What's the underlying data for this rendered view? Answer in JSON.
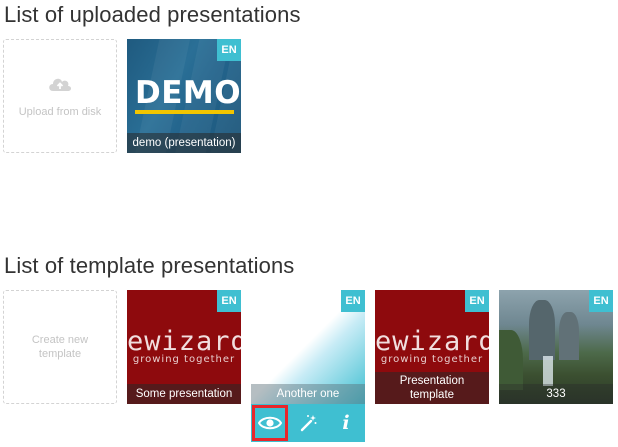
{
  "uploaded": {
    "title": "List of uploaded presentations",
    "upload_label": "Upload from disk",
    "items": [
      {
        "label": "demo (presentation)",
        "lang": "EN",
        "thumb_text": "DEMO"
      }
    ]
  },
  "templates": {
    "title": "List of template presentations",
    "create_label": "Create new template",
    "items": [
      {
        "label": "Some presentation",
        "lang": "EN",
        "logo": "ewizard",
        "tagline": "growing together"
      },
      {
        "label": "Another one",
        "lang": "EN"
      },
      {
        "label": "Presentation template",
        "lang": "EN",
        "logo": "ewizard",
        "tagline": "growing together"
      },
      {
        "label": "333",
        "lang": "EN"
      }
    ],
    "actions": [
      {
        "icon": "eye-icon",
        "title": "preview"
      },
      {
        "icon": "magic-wand-icon",
        "title": "edit"
      },
      {
        "icon": "info-icon",
        "title": "info"
      }
    ]
  },
  "colors": {
    "accent": "#3fbfd1",
    "brand_red": "#8e0a0d",
    "highlight": "#e8262b"
  }
}
